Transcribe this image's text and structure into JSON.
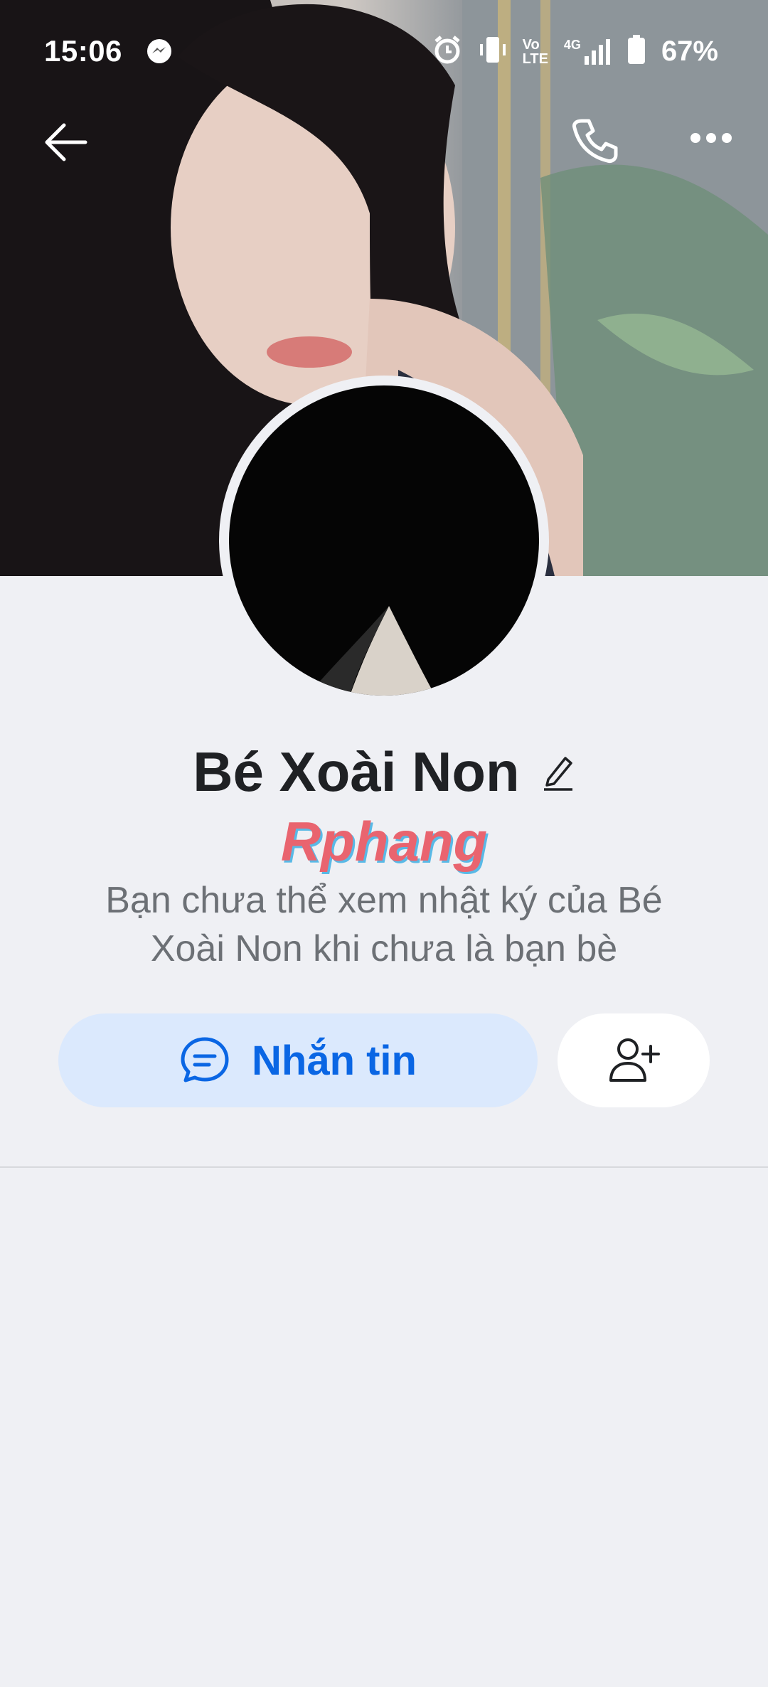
{
  "status_bar": {
    "time": "15:06",
    "messenger_icon": "messenger-icon",
    "alarm_icon": "alarm-icon",
    "vibrate_icon": "vibrate-icon",
    "volte_top": "Vo",
    "volte_bottom": "LTE",
    "network": "4G",
    "battery": "67%"
  },
  "header": {
    "back_icon": "arrow-left-icon",
    "call_icon": "phone-icon",
    "more_icon": "more-horizontal-icon"
  },
  "profile": {
    "name": "Bé Xoài Non",
    "edit_icon": "pencil-icon",
    "watermark": "Rphang",
    "notice": "Bạn chưa thể xem nhật ký của Bé Xoài Non khi chưa là bạn bè"
  },
  "actions": {
    "message_label": "Nhắn tin",
    "message_icon": "chat-bubble-icon",
    "add_friend_icon": "add-friend-icon"
  },
  "colors": {
    "accent": "#0a66e4",
    "button_bg": "#dbe9fd",
    "page_bg": "#eff0f4"
  }
}
